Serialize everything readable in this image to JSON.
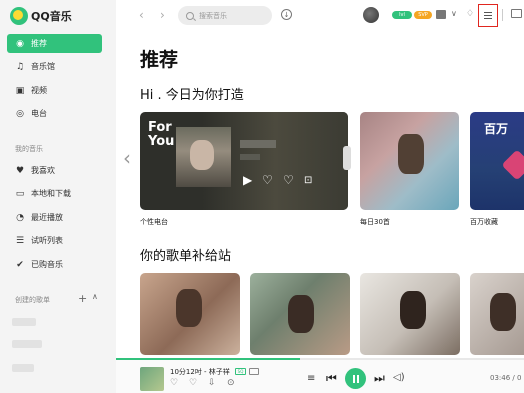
{
  "app": {
    "name": "QQ音乐"
  },
  "sidebar": {
    "items": [
      {
        "label": "推荐",
        "icon": "recommend-icon",
        "active": true
      },
      {
        "label": "音乐馆",
        "icon": "music-note-icon"
      },
      {
        "label": "视频",
        "icon": "video-icon"
      },
      {
        "label": "电台",
        "icon": "radio-icon"
      }
    ],
    "my_music_label": "我的音乐",
    "my_items": [
      {
        "label": "我喜欢",
        "icon": "heart-icon"
      },
      {
        "label": "本地和下载",
        "icon": "computer-icon"
      },
      {
        "label": "最近播放",
        "icon": "clock-icon"
      },
      {
        "label": "试听列表",
        "icon": "playlist-icon"
      },
      {
        "label": "已购音乐",
        "icon": "check-circle-icon"
      }
    ],
    "created_label": "创建的歌单"
  },
  "header": {
    "search_placeholder": "搜索音乐",
    "badge_green": "lvl",
    "badge_orange": "SVP"
  },
  "main": {
    "title": "推荐",
    "greeting": "Hi . 今日为你打造",
    "radio_logo_line1": "For",
    "radio_logo_line2": "You",
    "cards": [
      {
        "label": "个性电台"
      },
      {
        "label": "每日30首"
      },
      {
        "label": "百万收藏"
      }
    ],
    "hot_card_title": "百万",
    "section2_title": "你的歌单补给站"
  },
  "player": {
    "song": "10分12吋 - 林子祥",
    "quality_badge": "SQ",
    "time": "03:46 / 0",
    "progress": 0.45
  },
  "colors": {
    "accent": "#31c27c",
    "highlight_box": "#e0261f"
  }
}
